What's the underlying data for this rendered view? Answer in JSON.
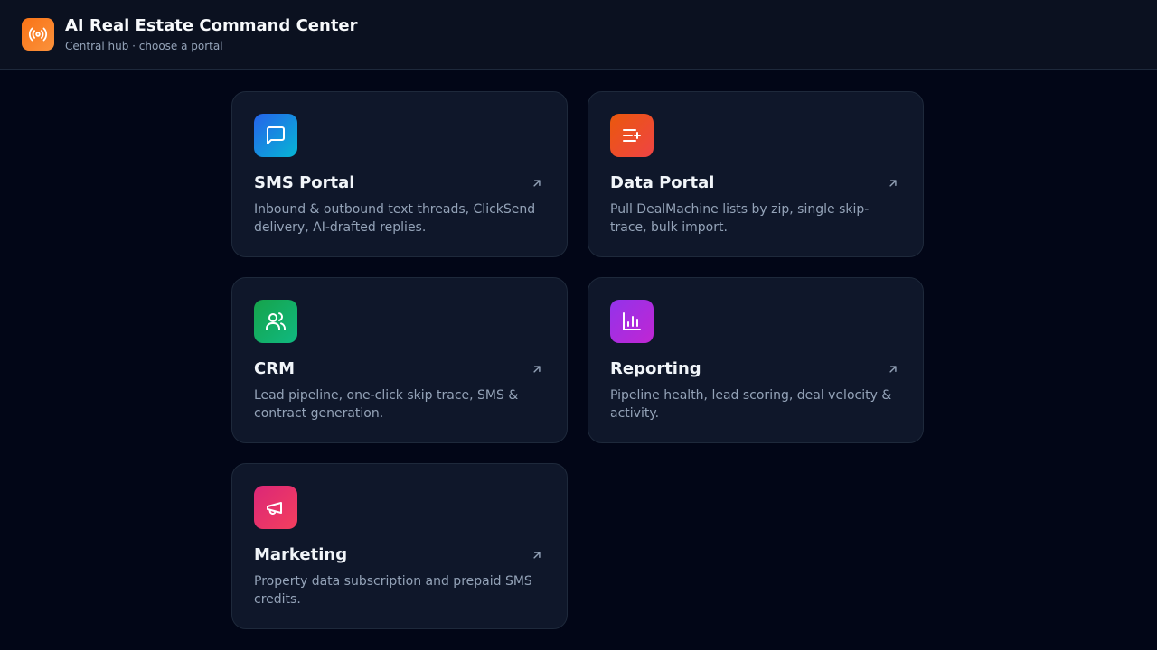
{
  "header": {
    "title": "AI Real Estate Command Center",
    "subtitle": "Central hub · choose a portal",
    "logo_icon": "broadcast-icon"
  },
  "portals": [
    {
      "title": "SMS Portal",
      "description": "Inbound & outbound text threads, ClickSend delivery, AI-drafted replies.",
      "icon": "chat-bubble-icon",
      "color": "#2563eb"
    },
    {
      "title": "Data Portal",
      "description": "Pull DealMachine lists by zip, single skip-trace, bulk import.",
      "icon": "list-plus-icon",
      "color": "#ea580c"
    },
    {
      "title": "CRM",
      "description": "Lead pipeline, one-click skip trace, SMS & contract generation.",
      "icon": "users-icon",
      "color": "#16a34a"
    },
    {
      "title": "Reporting",
      "description": "Pipeline health, lead scoring, deal velocity & activity.",
      "icon": "bar-chart-icon",
      "color": "#9333ea"
    },
    {
      "title": "Marketing",
      "description": "Property data subscription and prepaid SMS credits.",
      "icon": "megaphone-icon",
      "color": "#db2777"
    }
  ],
  "colors": {
    "background": "#020617",
    "card": "#0f172a",
    "border": "#1e293b",
    "accent": "#f97316"
  }
}
